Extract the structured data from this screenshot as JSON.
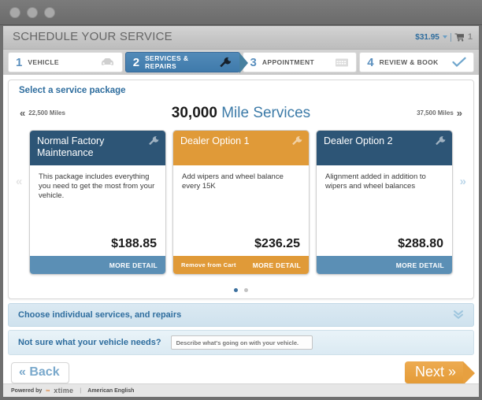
{
  "window": {
    "buttons": [
      "close",
      "minimize",
      "maximize"
    ]
  },
  "header": {
    "title": "SCHEDULE YOUR SERVICE",
    "cart_price": "$31.95",
    "cart_count": "1"
  },
  "steps": [
    {
      "num": "1",
      "label": "VEHICLE",
      "icon": "car-icon",
      "active": false
    },
    {
      "num": "2",
      "label": "SERVICES & REPAIRS",
      "icon": "wrench-icon",
      "active": true
    },
    {
      "num": "3",
      "label": "APPOINTMENT",
      "icon": "calendar-icon",
      "active": false
    },
    {
      "num": "4",
      "label": "REVIEW & BOOK",
      "icon": "check-icon",
      "active": false
    }
  ],
  "panel": {
    "title": "Select a service package",
    "prev_mileage": "22,500 Miles",
    "next_mileage": "37,500 Miles",
    "mileage_value": "30,000",
    "mileage_suffix": "Mile Services",
    "prev_chevrons": "«",
    "next_chevrons": "»",
    "side_prev": "«",
    "side_next": "»",
    "cards": [
      {
        "title": "Normal Factory Maintenance",
        "description": "This package includes everything you need to get the most from your vehicle.",
        "price": "$188.85",
        "more_detail": "MORE DETAIL",
        "remove_label": "",
        "theme": "blue",
        "in_cart": false
      },
      {
        "title": "Dealer Option 1",
        "description": "Add wipers and wheel balance every 15K",
        "price": "$236.25",
        "more_detail": "MORE DETAIL",
        "remove_label": "Remove from Cart",
        "theme": "orange",
        "in_cart": true
      },
      {
        "title": "Dealer Option 2",
        "description": "Alignment added in addition to wipers and wheel balances",
        "price": "$288.80",
        "more_detail": "MORE DETAIL",
        "remove_label": "",
        "theme": "blue",
        "in_cart": false
      }
    ],
    "carousel_dots": 2,
    "carousel_active": 0
  },
  "accordion": {
    "label": "Choose individual services, and repairs",
    "chevron": "»"
  },
  "not_sure": {
    "label": "Not sure what your vehicle needs?",
    "placeholder": "Describe what's going on with your vehicle.",
    "value": ""
  },
  "nav": {
    "back_label": "« Back",
    "next_label": "Next »"
  },
  "footer": {
    "powered_by": "Powered by",
    "brand_mark": "∞",
    "brand_name": "xtime",
    "separator": "|",
    "language": "American English"
  },
  "colors": {
    "brand_blue": "#2e6d9e",
    "card_blue": "#2d5576",
    "card_blue_foot": "#5b8fb5",
    "card_orange": "#e09a38",
    "next_orange": "#e7a040",
    "step_active": "#3f7aab"
  }
}
